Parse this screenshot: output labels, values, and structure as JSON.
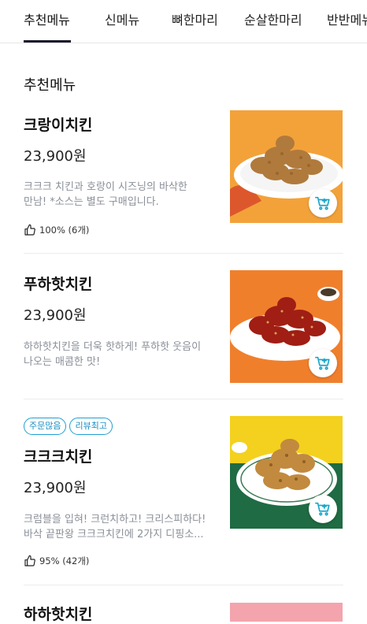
{
  "tabs": [
    "추천메뉴",
    "신메뉴",
    "뼈한마리",
    "순살한마리",
    "반반메뉴"
  ],
  "section_title": "추천메뉴",
  "items": [
    {
      "name": "크랑이치킨",
      "price": "23,900원",
      "desc_lines": [
        "크크크 치킨과 호랑이 시즈닝의 바삭한",
        "만남! *소스는 별도 구매입니다."
      ],
      "likes": "100% (6개)",
      "photo_bg": "#f3a23a"
    },
    {
      "name": "푸하핫치킨",
      "price": "23,900원",
      "desc_lines": [
        "하하핫치킨을 더욱 핫하게! 푸하핫 웃음이",
        "나오는 매콤한 맛!"
      ],
      "photo_bg": "#f07f2c"
    },
    {
      "name": "크크크치킨",
      "price": "23,900원",
      "badges": [
        "주문많음",
        "리뷰최고"
      ],
      "desc_lines": [
        "크럼블을 입혀! 크런치하고! 크리스피하다!",
        "바삭 끝판왕 크크크치킨에 2가지 디핑소..."
      ],
      "likes": "95% (42개)",
      "photo_bg": "#f4d11e"
    },
    {
      "name": "하하핫치킨",
      "photo_bg": "#f3a4ad"
    }
  ],
  "colors": {
    "accent_badge": "#1ea0d2",
    "cart_icon": "#19a6c9",
    "desc_text": "#8a8f98"
  },
  "icons": {
    "cart": "cart-plus-icon",
    "like": "thumbs-up-icon"
  }
}
